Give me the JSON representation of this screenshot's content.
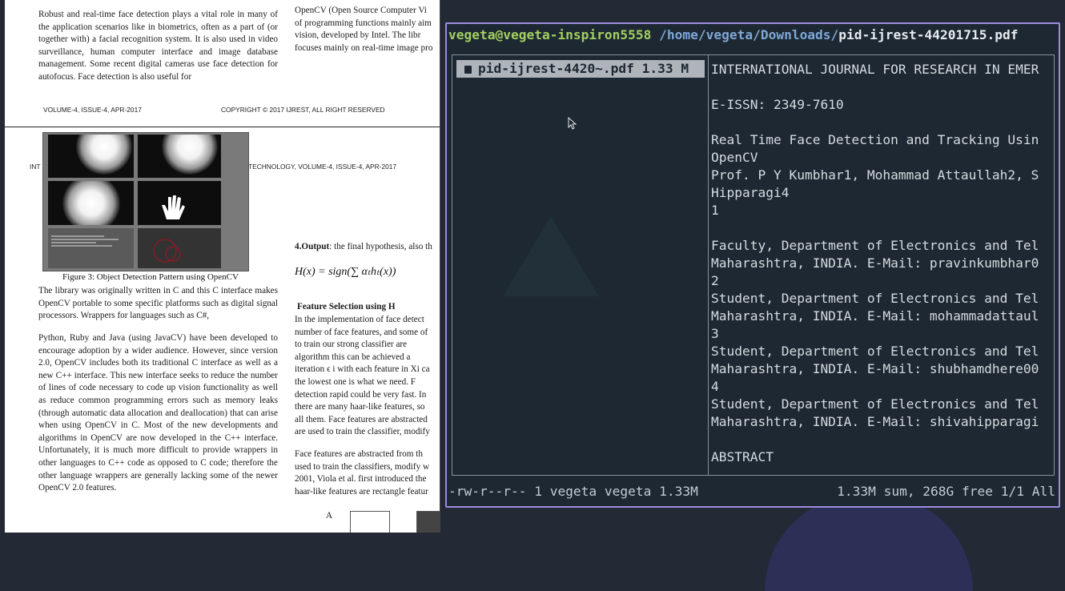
{
  "pdf": {
    "top_left_paragraph": "Robust and real-time face detection plays a vital role in many of the application scenarios like in biometrics, often as a part of (or together with) a facial recognition system. It is also used in video surveillance, human computer interface and image database management. Some recent digital cameras use face detection for autofocus. Face detection is also useful for",
    "top_right_lines": [
      "OpenCV (Open Source Computer Vi",
      "of programming functions mainly aim",
      "vision, developed by Intel. The libr",
      "focuses mainly on real-time image pro"
    ],
    "footer_volume": "VOLUME-4, ISSUE-4, APR-2017",
    "footer_copyright": "COPYRIGHT © 2017 IJREST, ALL RIGHT RESERVED",
    "header_left": "INT",
    "header_right": "TECHNOLOGY, VOLUME-4, ISSUE-4, APR-2017",
    "figure_caption": "Figure 3: Object Detection Pattern using OpenCV",
    "left_para1": "The library was originally written in C and this C interface makes OpenCV portable to some specific platforms such as digital signal processors. Wrappers for languages such as C#,",
    "left_para2": "Python, Ruby and Java (using JavaCV) have been developed to encourage adoption by a wider audience. However, since version 2.0, OpenCV includes both its traditional C interface as well as a new C++ interface. This new interface seeks to reduce the number of lines of code necessary to code up vision functionality as well as reduce common programming errors such as memory leaks (through automatic data allocation and deallocation) that can arise when using OpenCV in C. Most of the new developments and algorithms in OpenCV are now developed in the C++ interface. Unfortunately, it is much more difficult to provide wrappers in other languages to C++ code as opposed to C code; therefore the other language wrappers are generally lacking some of the newer OpenCV 2.0 features.",
    "output_bold": "4.Output",
    "output_rest": ": the final hypothesis, also th",
    "formula": "H(x) = sign(∑ αₜhₜ(x))",
    "feature_heading": "Feature    Selection    using    H",
    "right_para1_lines": [
      "In the implementation of face detect",
      "number of face features, and some of",
      "to train our strong classifier are",
      "algorithm this can be achieved a",
      "iteration ϵ i with each feature in Xi ca",
      "the lowest one is what we need. F",
      "detection rapid could be very fast. In",
      "there are many haar-like features, so",
      "all them. Face features are abstracted",
      "are used to train the classifier, modify"
    ],
    "right_para2_lines": [
      "Face features are abstracted from th",
      "used to train the classifiers, modify w",
      "2001, Viola et al. first introduced the",
      "haar-like features are rectangle featur"
    ],
    "nav_letter": "A"
  },
  "terminal": {
    "title_user": "vegeta@vegeta-inspiron5558",
    "title_path": "/home/vegeta/Downloads/",
    "title_file": "pid-ijrest-44201715.pdf",
    "selected_file": "pid-ijrest-4420~.pdf 1.33 M",
    "preview_lines": [
      "INTERNATIONAL JOURNAL FOR RESEARCH IN EMER",
      "",
      "E-ISSN: 2349-7610",
      "",
      "Real Time Face Detection and Tracking Usin",
      "OpenCV",
      "Prof. P Y Kumbhar1, Mohammad Attaullah2, S",
      "Hipparagi4",
      "1",
      "",
      "Faculty, Department of Electronics and Tel",
      "Maharashtra, INDIA. E-Mail: pravinkumbhar0",
      "2",
      "Student, Department of Electronics and Tel",
      "Maharashtra, INDIA. E-Mail: mohammadattaul",
      "3",
      "Student, Department of Electronics and Tel",
      "Maharashtra, INDIA. E-Mail: shubhamdhere00",
      "4",
      "Student, Department of Electronics and Tel",
      "Maharashtra, INDIA. E-Mail: shivahipparagi",
      "",
      "ABSTRACT"
    ],
    "status_left": "-rw-r--r-- 1 vegeta vegeta 1.33M",
    "status_right": "1.33M sum, 268G free  1/1  All"
  },
  "colors": {
    "terminal_bg": "#1d2832",
    "terminal_border": "#9c8cdf",
    "user_green": "#a3cf62",
    "path_blue": "#7fa7d6"
  }
}
